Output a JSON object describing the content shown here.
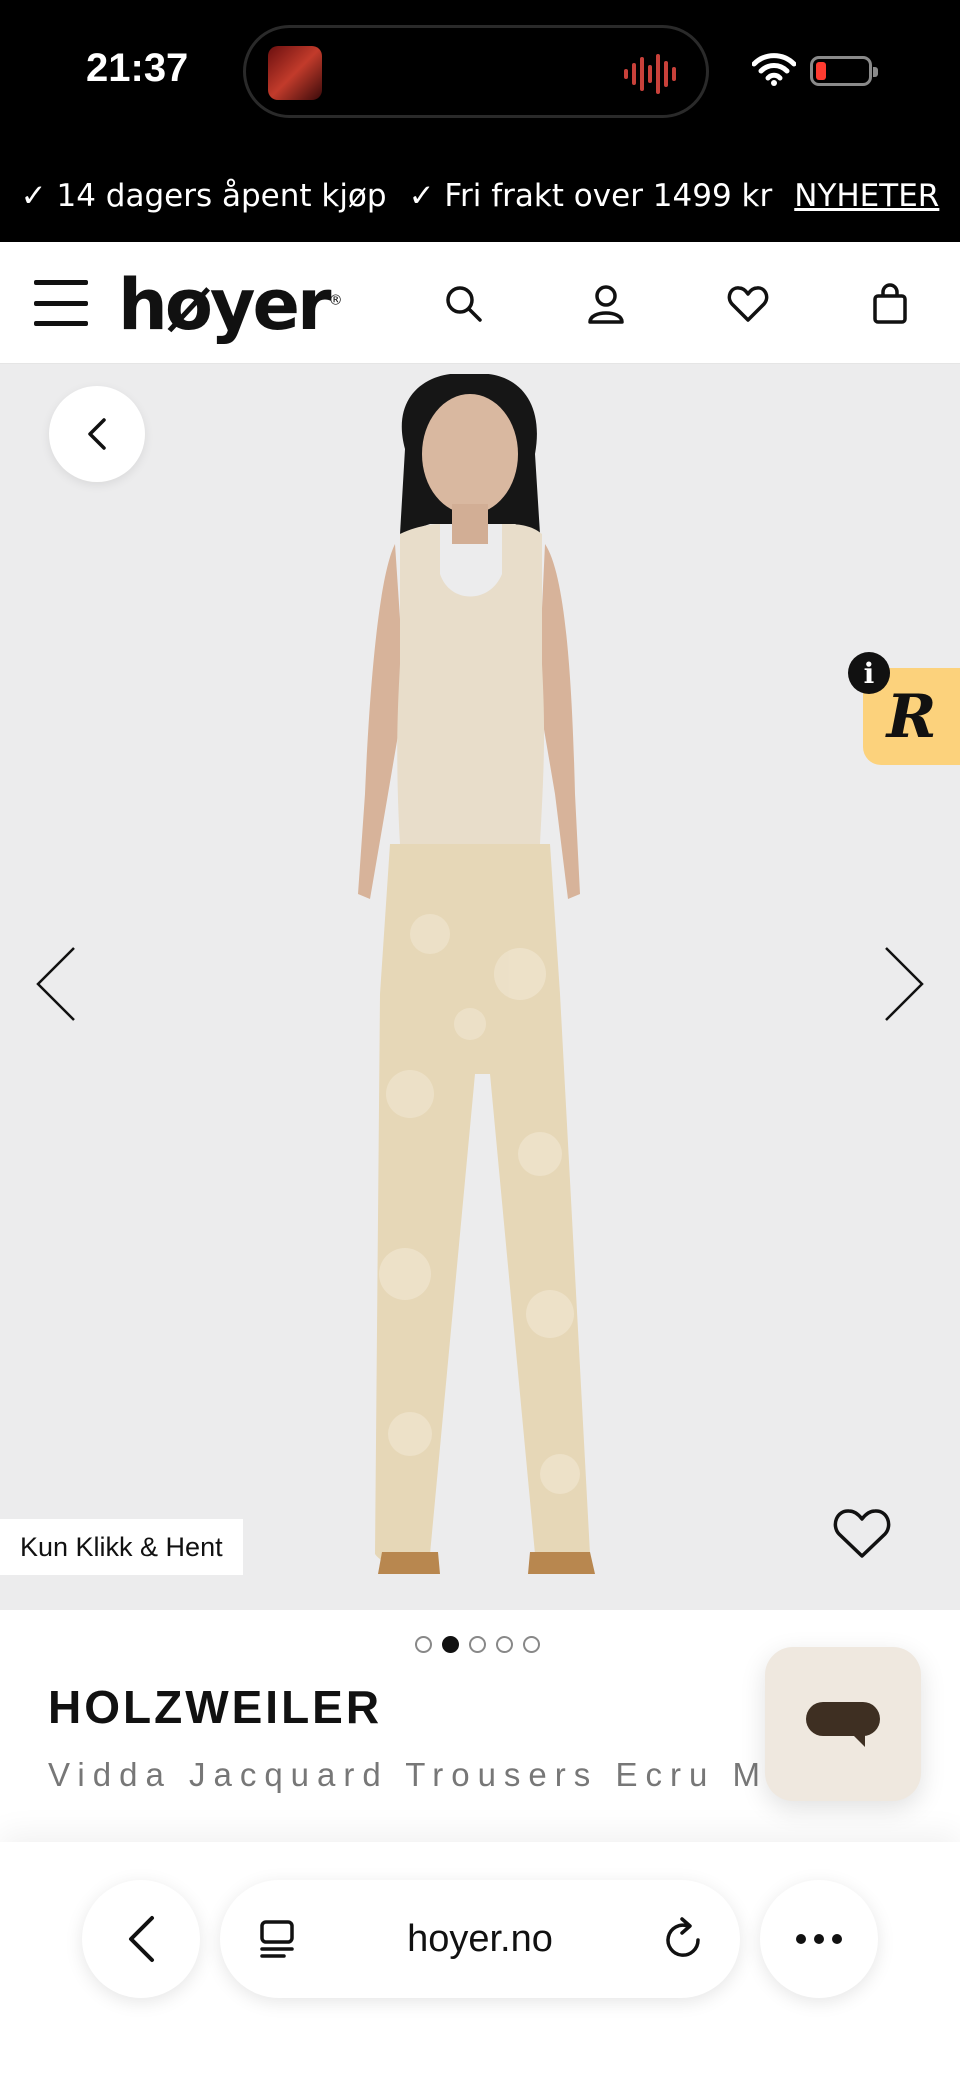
{
  "status_bar": {
    "time": "21:37",
    "battery_color": "#ff3b30"
  },
  "promo": {
    "item1": "✓ 14 dagers åpent kjøp",
    "item2": "✓ Fri frakt over 1499 kr",
    "link": "NYHETER"
  },
  "header": {
    "logo": "høyer",
    "logo_mark": "®",
    "icons": [
      "menu-icon",
      "search-icon",
      "account-icon",
      "heart-icon",
      "shopping-bag-icon"
    ]
  },
  "gallery": {
    "pickup_tag": "Kun Klikk & Hent",
    "badge_letter": "R",
    "info_letter": "i",
    "image_count": 5,
    "active_image": 2,
    "badge_color": "#fcd27c"
  },
  "product": {
    "brand": "HOLZWEILER",
    "name": "Vidda Jacquard Trousers Ecru Mi"
  },
  "chat": {
    "color": "#3e2f22"
  },
  "browser": {
    "url": "hoyer.no"
  }
}
